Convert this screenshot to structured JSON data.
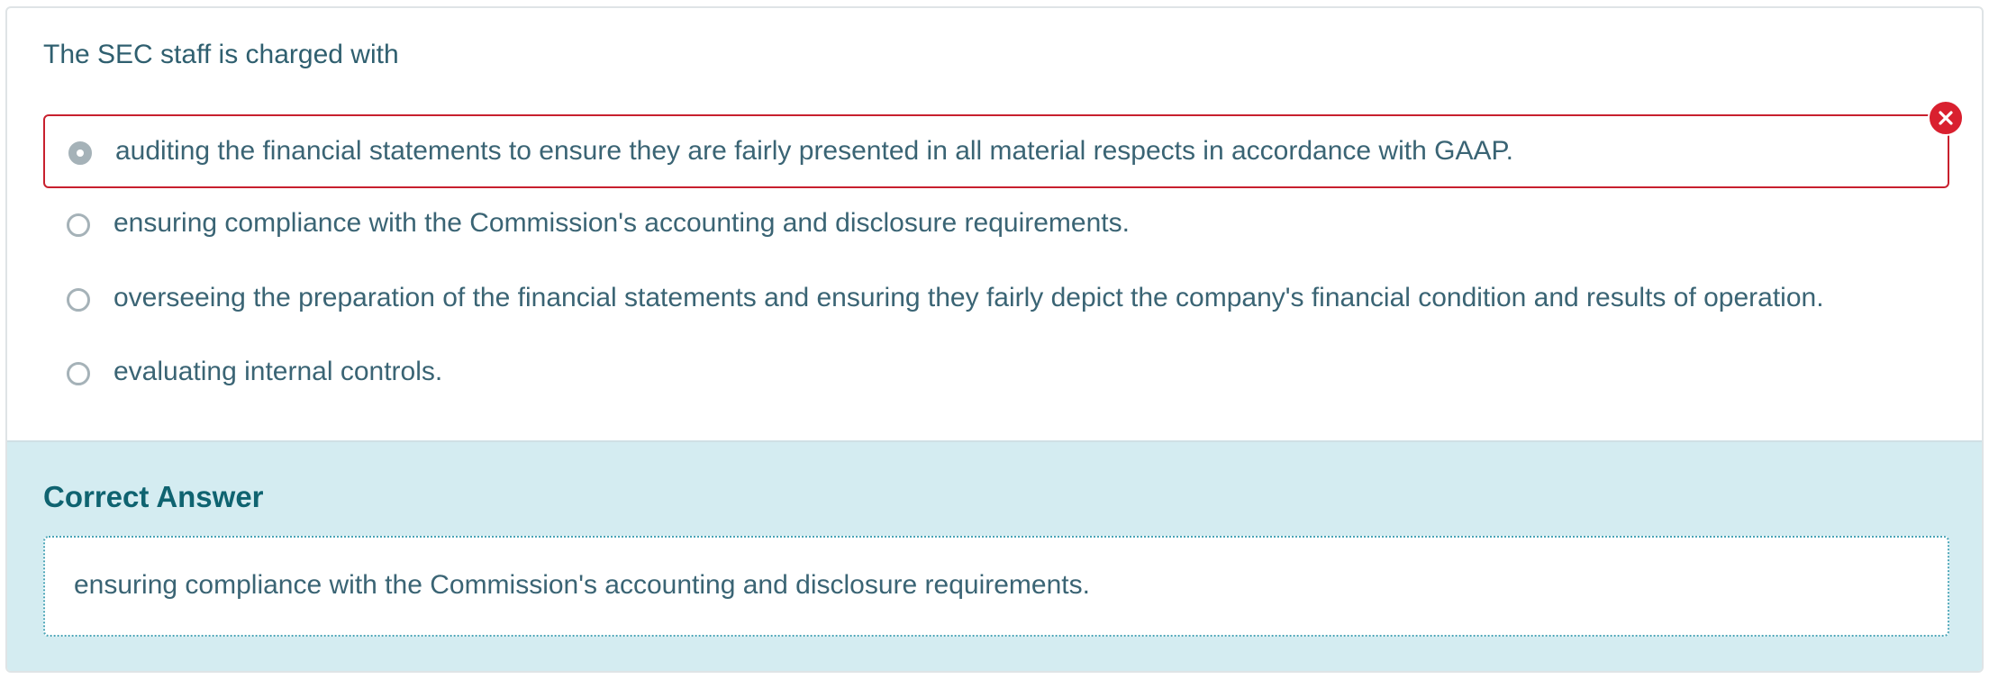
{
  "question": {
    "prompt": "The SEC staff is charged with",
    "options": [
      {
        "label": "auditing the financial statements to ensure they are fairly presented in all material respects in accordance with GAAP.",
        "selected": true,
        "status": "incorrect"
      },
      {
        "label": "ensuring compliance with the Commission's accounting and disclosure requirements.",
        "selected": false
      },
      {
        "label": "overseeing the preparation of the financial statements and ensuring they fairly depict the company's financial condition and results of operation.",
        "selected": false
      },
      {
        "label": "evaluating internal controls.",
        "selected": false
      }
    ]
  },
  "feedback": {
    "heading": "Correct Answer",
    "answer": "ensuring compliance with the Commission's accounting and disclosure requirements."
  },
  "colors": {
    "incorrect": "#d9202f",
    "answer_background": "#d4ecf1",
    "heading": "#0f6370",
    "text": "#2f5f6f"
  },
  "icons": {
    "wrong": "x-circle-icon",
    "radio_selected": "radio-checked-icon",
    "radio_unselected": "radio-unchecked-icon"
  }
}
